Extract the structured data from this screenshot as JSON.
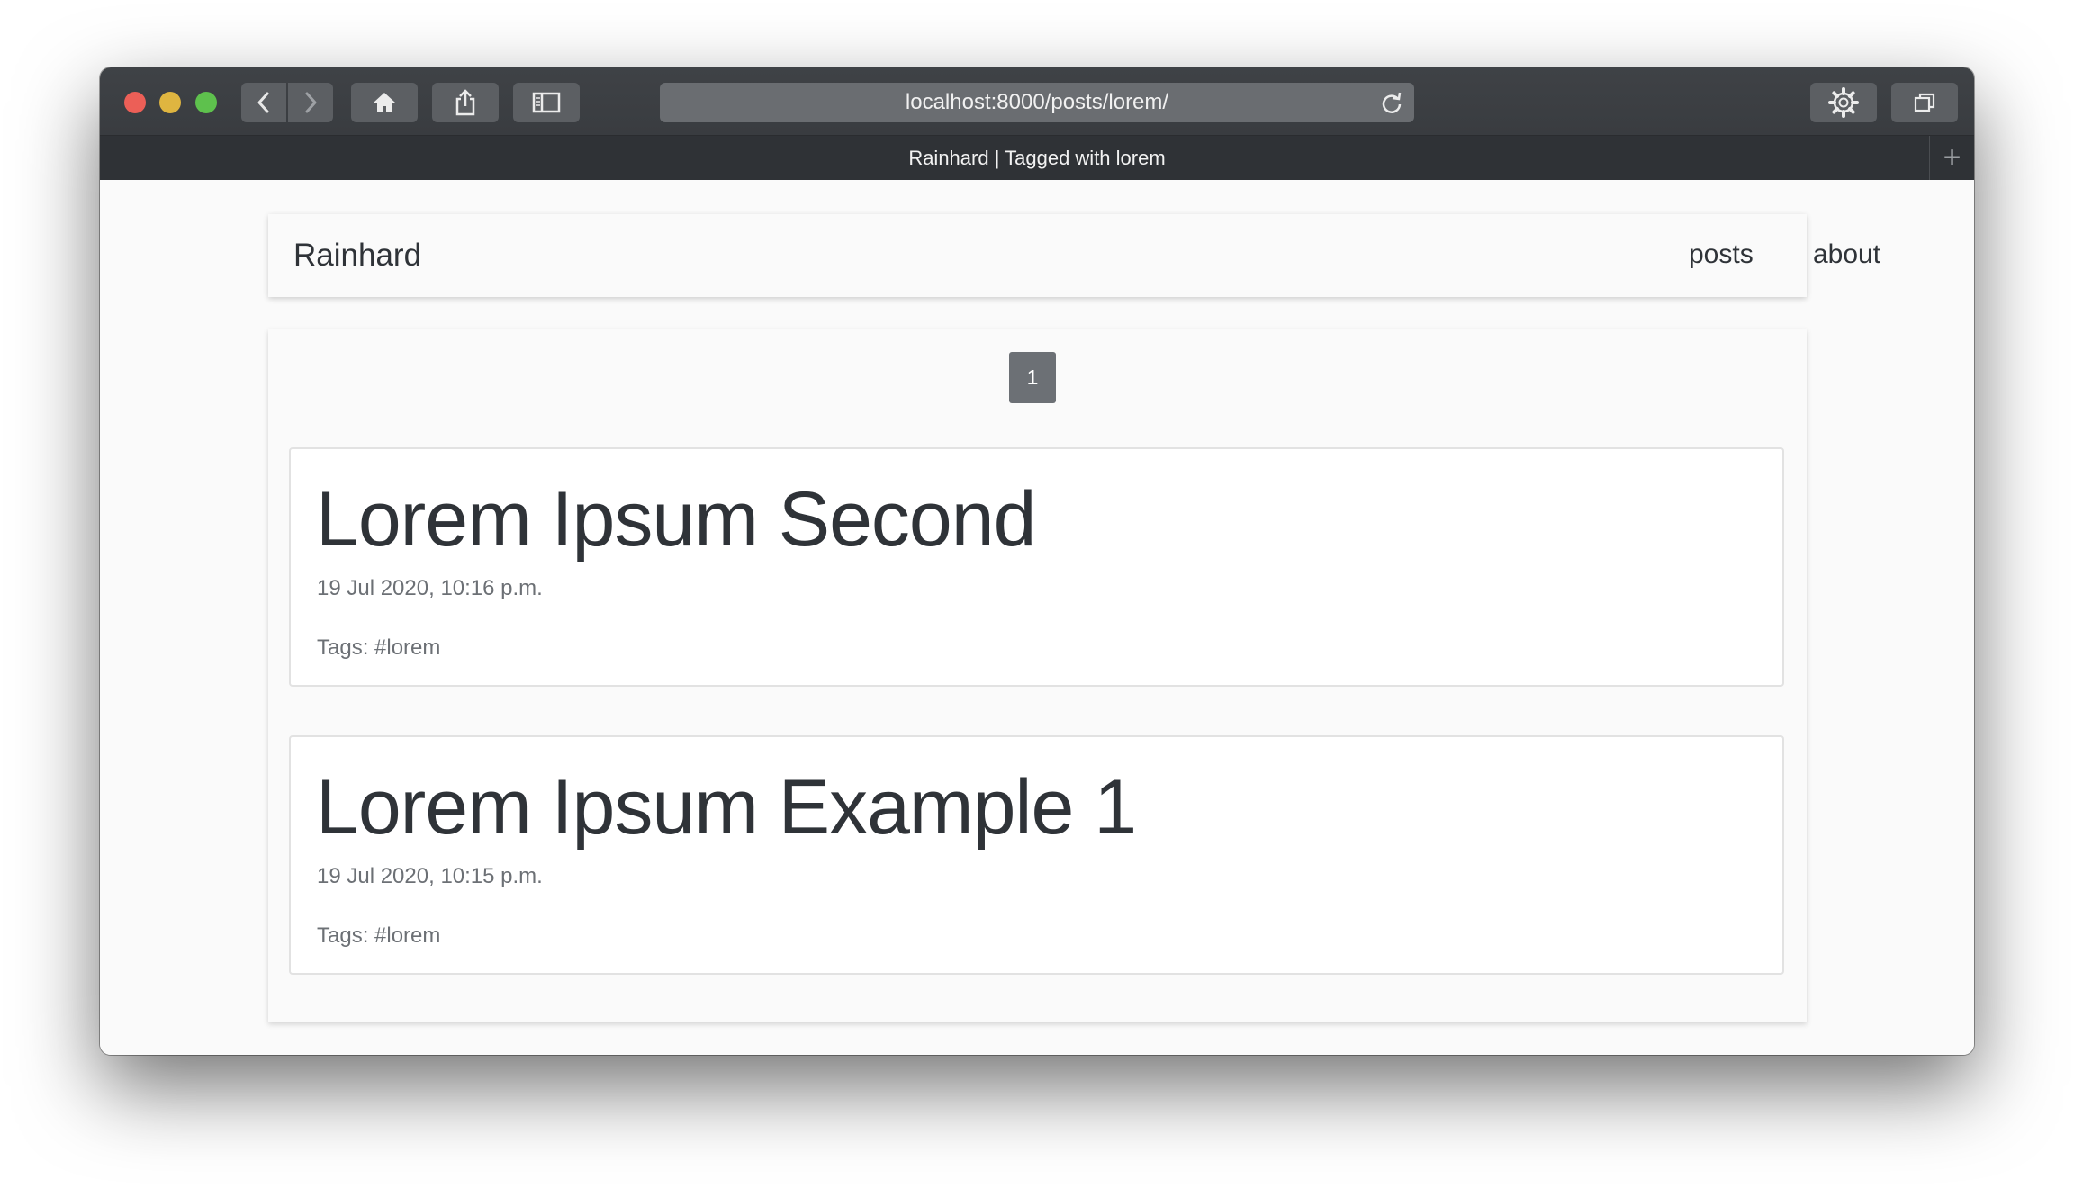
{
  "browser": {
    "url": "localhost:8000/posts/lorem/",
    "tab_title": "Rainhard | Tagged with lorem",
    "new_tab_symbol": "+",
    "icons": [
      "back-icon",
      "forward-icon",
      "home-icon",
      "share-icon",
      "sidebar-icon",
      "reload-icon",
      "settings-gear-icon",
      "tabs-overview-icon"
    ]
  },
  "navbar": {
    "brand": "Rainhard",
    "links": [
      {
        "label": "posts"
      },
      {
        "label": "about"
      }
    ]
  },
  "pagination": {
    "current_page": "1"
  },
  "posts": [
    {
      "title": "Lorem Ipsum Second",
      "date": "19 Jul 2020, 10:16 p.m.",
      "tags": "Tags: #lorem"
    },
    {
      "title": "Lorem Ipsum Example 1",
      "date": "19 Jul 2020, 10:15 p.m.",
      "tags": "Tags: #lorem"
    }
  ],
  "colors": {
    "toolbar": "#3c3f43",
    "tabbar": "#2f3236",
    "page_background": "#fafafa",
    "text_dark": "#2f3338",
    "text_muted": "#6c7075",
    "pager_active": "#6c7075",
    "close": "#ec5f57",
    "minimize": "#dfb540",
    "zoom": "#5ec14d"
  }
}
